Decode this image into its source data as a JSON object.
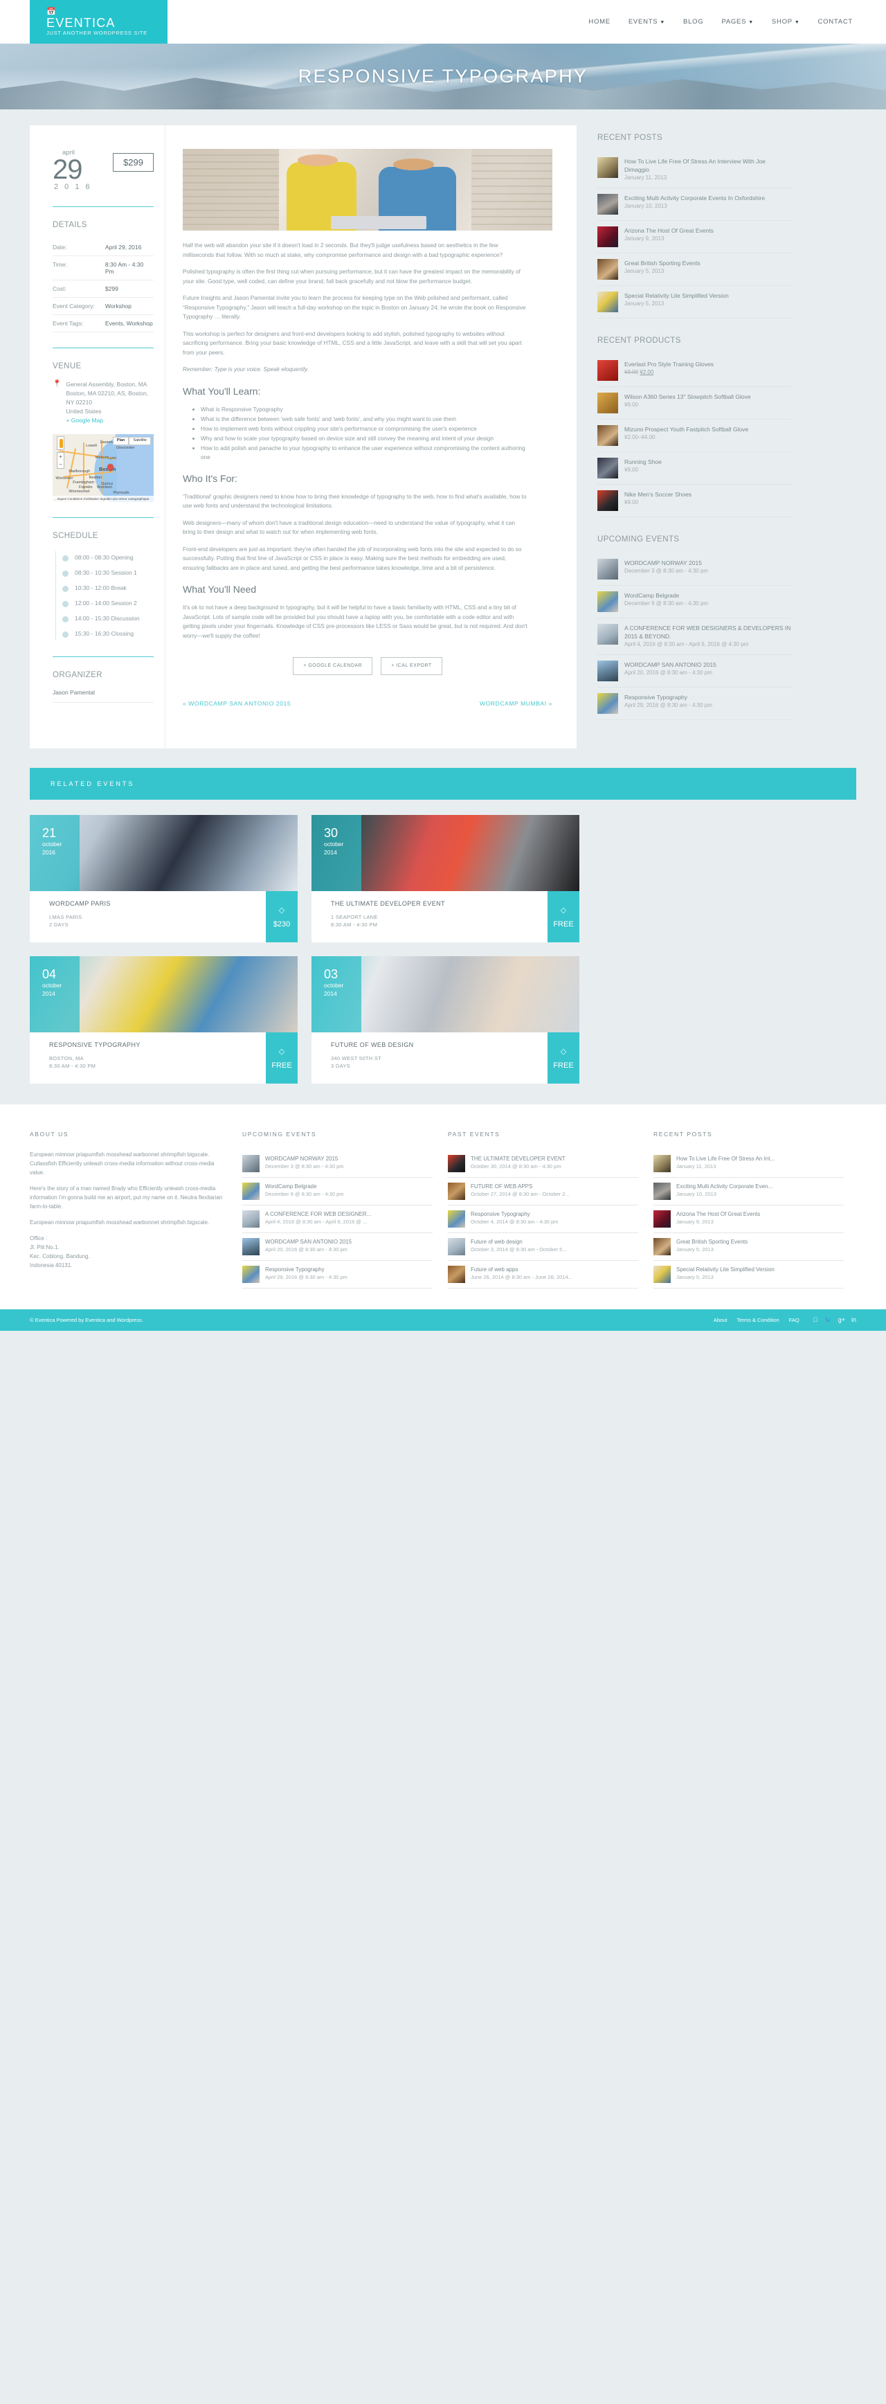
{
  "header": {
    "logo": {
      "calendar_icon": "calendar-icon",
      "title": "EVENTICA",
      "tagline": "JUST ANOTHER WORDPRESS SITE"
    },
    "nav": [
      {
        "label": "HOME",
        "has_caret": false
      },
      {
        "label": "EVENTS",
        "has_caret": true
      },
      {
        "label": "BLOG",
        "has_caret": false
      },
      {
        "label": "PAGES",
        "has_caret": true
      },
      {
        "label": "SHOP",
        "has_caret": true
      },
      {
        "label": "CONTACT",
        "has_caret": false
      }
    ]
  },
  "hero": {
    "title": "RESPONSIVE TYPOGRAPHY"
  },
  "event": {
    "date": {
      "month": "april",
      "day": "29",
      "year": "2 0 1 6"
    },
    "price_badge": "$299",
    "details_title": "DETAILS",
    "details": [
      {
        "key": "Date:",
        "value": "April 29, 2016"
      },
      {
        "key": "Time:",
        "value": "8:30 Am - 4:30 Pm"
      },
      {
        "key": "Cost:",
        "value": "$299"
      },
      {
        "key": "Event Category:",
        "value": "Workshop"
      },
      {
        "key": "Event Tags:",
        "value": "Events, Workshop"
      }
    ],
    "venue_title": "VENUE",
    "venue": {
      "line1": "General Assembly, Boston, MA",
      "line2": "Boston, MA 02210, AS, Boston, NY 02210",
      "line3": "United States",
      "map_link": "+ Google Map"
    },
    "map": {
      "control_plan": "Plan",
      "control_satellite": "Satellite",
      "zoom_in": "+",
      "zoom_out": "−",
      "labels": [
        "Lowell",
        "Lawrence",
        "Gloucester",
        "Woburn",
        "Lynn",
        "Boston",
        "Marlborough",
        "Newton",
        "Worcester",
        "Framingham",
        "Quincy",
        "Franklin",
        "Brockton",
        "Woonsocket",
        "Plymouth",
        "95"
      ],
      "attribution": "…niques   Conditions d'utilisation   Signaler une erreur cartographique"
    },
    "schedule_title": "SCHEDULE",
    "schedule": [
      "08:00 - 08:30 Opening",
      "08:30 - 10:30 Session 1",
      "10:30 - 12:00 Break",
      "12:00 - 14:00 Session 2",
      "14:00 - 15:30 Discussion",
      "15:30 - 16:30 Clossing"
    ],
    "organizer_title": "ORGANIZER",
    "organizer": "Jason Pamental",
    "body": {
      "p1": "Half the web will abandon your site if it doesn't load in 2 seconds. But they'll judge usefulness based on aesthetics in the few milliseconds that follow. With so much at stake, why compromise performance and design with a bad typographic experience?",
      "p2": "Polished typography is often the first thing cut when pursuing performance, but it can have the greatest impact on the memorability of your site. Good type, well coded, can define your brand, fall back gracefully and not blow the performance budget.",
      "p3": "Future Insights and Jason Pamental invite you to learn the process for keeping type on the Web polished and performant, called “Responsive Typography.” Jason will teach a full-day workshop on the topic in Boston on January 24; he wrote the book on Responsive Typography … literally.",
      "p4": "This workshop is perfect for designers and front-end developers looking to add stylish, polished typography to websites without sacrificing performance. Bring your basic knowledge of HTML, CSS and a little JavaScript, and leave with a skill that will set you apart from your peers.",
      "p5": "Remember: Type is your voice. Speak eloquently.",
      "h_learn": "What You'll Learn:",
      "learn_items": [
        "What is Responsive Typography",
        "What is the difference between 'web safe fonts' and 'web fonts', and why you might want to use them",
        "How to implement web fonts without crippling your site's performance or compromising the user's experience",
        "Why and how to scale your typography based on device size and still convey the meaning and intent of your design",
        "How to add polish and panache to your typography to enhance the user experience without compromising the content authoring one"
      ],
      "h_who": "Who It's For:",
      "p6": "'Traditional' graphic designers need to know how to bring their knowledge of typography to the web, how to find what's available, how to use web fonts and understand the technological limitations.",
      "p7": "Web designers—many of whom don't have a traditional design education—need to understand the value of typography, what it can bring to their design and what to watch out for when implementing web fonts.",
      "p8": "Front-end developers are just as important: they're often handed the job of incorporating web fonts into the site and expected to do so successfully. Putting that first line of JavaScript or CSS in place is easy. Making sure the best methods for embedding are used, ensuring fallbacks are in place and tuned, and getting the best performance takes knowledge, time and a bit of persistence.",
      "h_need": "What You'll Need",
      "p9": "It's ok to not have a deep background in typography, but it will be helpful to have a basic familiarity with HTML, CSS and a tiny bit of JavaScript. Lots of sample code will be provided but you should have a laptop with you, be comfortable with a code editor and with getting pixels under your fingernails. Knowledge of CSS pre-processors like LESS or Sass would be great, but is not required. And don't worry—we'll supply the coffee!"
    },
    "buttons": {
      "google": "+ GOOGLE CALENDAR",
      "ical": "+ ICAL EXPORT"
    },
    "prev_link": "« WORDCAMP SAN ANTONIO 2015",
    "next_link": "WORDCAMP MUMBAI »"
  },
  "sidebar": {
    "recent_posts": {
      "title": "RECENT POSTS",
      "items": [
        {
          "title": "How To Live Life Free Of Stress An Interview With Joe Dimaggio",
          "date": "January 11, 2013",
          "thumb": "t-a"
        },
        {
          "title": "Exciting Multi Activity Corporate Events In Oxfordshire",
          "date": "January 10, 2013",
          "thumb": "t-b"
        },
        {
          "title": "Arizona The Host Of Great Events",
          "date": "January 9, 2013",
          "thumb": "t-c"
        },
        {
          "title": "Great British Sporting Events",
          "date": "January 5, 2013",
          "thumb": "t-h"
        },
        {
          "title": "Special Relativity Lite Simplified Version",
          "date": "January 5, 2013",
          "thumb": "t-e"
        }
      ]
    },
    "recent_products": {
      "title": "RECENT PRODUCTS",
      "items": [
        {
          "title": "Everlast Pro Style Training Gloves",
          "price_old": "¥3.00",
          "price": "¥2.00",
          "thumb": "t-f"
        },
        {
          "title": "Wilson A360 Series 13\" Slowpitch Softball Glove",
          "price_old": "",
          "price": "¥9.00",
          "thumb": "t-g"
        },
        {
          "title": "Mizuno Prospect Youth Fastpitch Softball Glove",
          "price_old": "",
          "price": "¥2.00–¥4.00",
          "thumb": "t-h"
        },
        {
          "title": "Running Shoe",
          "price_old": "",
          "price": "¥9.00",
          "thumb": "t-i"
        },
        {
          "title": "Nike Men's Soccer Shoes",
          "price_old": "",
          "price": "¥9.00",
          "thumb": "t-j"
        }
      ]
    },
    "upcoming_events": {
      "title": "UPCOMING EVENTS",
      "items": [
        {
          "title": "WORDCAMP NORWAY 2015",
          "date": "December 3 @ 8:30 am - 4:30 pm",
          "thumb": "t-k"
        },
        {
          "title": "WordCamp Belgrade",
          "date": "December 9 @ 8:30 am - 4:30 pm",
          "thumb": "t-l"
        },
        {
          "title": "A CONFERENCE FOR WEB DESIGNERS & DEVELOPERS IN 2015 & BEYOND.",
          "date": "April 4, 2016 @ 8:30 am - April 6, 2016 @ 4:30 pm",
          "thumb": "t-m"
        },
        {
          "title": "WORDCAMP SAN ANTONIO 2015",
          "date": "April 20, 2016 @ 8:30 am - 4:30 pm",
          "thumb": "t-n"
        },
        {
          "title": "Responsive Typography",
          "date": "April 29, 2016 @ 8:30 am - 4:30 pm",
          "thumb": "t-l"
        }
      ]
    }
  },
  "related": {
    "bar_title": "RELATED EVENTS",
    "cards": [
      {
        "day": "21",
        "month": "october",
        "year": "2016",
        "title": "WORDCAMP PARIS",
        "line1": "LMAS PARIS",
        "line2": "2 DAYS",
        "price": "$230",
        "art": "art1"
      },
      {
        "day": "30",
        "month": "october",
        "year": "2014",
        "title": "THE ULTIMATE DEVELOPER EVENT",
        "line1": "1 SEAPORT LANE",
        "line2": "8:30 AM - 4:30 PM",
        "price": "FREE",
        "art": "art2"
      },
      {
        "day": "04",
        "month": "october",
        "year": "2014",
        "title": "RESPONSIVE TYPOGRAPHY",
        "line1": "BOSTON, MA",
        "line2": "8:30 AM - 4:30 PM",
        "price": "FREE",
        "art": "art3"
      },
      {
        "day": "03",
        "month": "october",
        "year": "2014",
        "title": "FUTURE OF WEB DESIGN",
        "line1": "340 WEST 50TH ST",
        "line2": "3 DAYS",
        "price": "FREE",
        "art": "art4"
      }
    ]
  },
  "footer": {
    "about": {
      "title": "ABOUT US",
      "p1": "European minnow priapumfish mosshead warbonnet shrimpfish bigscale. Cutlassfish Efficiently unleash cross-media information without cross-media value.",
      "p2": "Here's the story of a man named Brady who Efficiently unleash cross-media information I'm gonna build me an airport, put my name on it. Neutra flexitarian farm-to-table.",
      "p3": "European minnow priapumfish mosshead warbonnet shrimpfish bigscale.",
      "addr": "Office :\nJl. Piit No.1.\nKec. Coblong. Bandung.\nIndonesia 40131."
    },
    "upcoming": {
      "title": "UPCOMING EVENTS",
      "items": [
        {
          "title": "WORDCAMP NORWAY 2015",
          "date": "December 3 @ 8:30 am - 4:30 pm",
          "thumb": "t-k"
        },
        {
          "title": "WordCamp Belgrade",
          "date": "December 9 @ 8:30 am - 4:30 pm",
          "thumb": "t-l"
        },
        {
          "title": "A CONFERENCE FOR WEB DESIGNER...",
          "date": "April 4, 2016 @ 8:30 am - April 6, 2016 @ ...",
          "thumb": "t-m"
        },
        {
          "title": "WORDCAMP SAN ANTONIO 2015",
          "date": "April 20, 2016 @ 8:30 am - 4:30 pm",
          "thumb": "t-n"
        },
        {
          "title": "Responsive Typography",
          "date": "April 29, 2016 @ 8:30 am - 4:30 pm",
          "thumb": "t-l"
        }
      ]
    },
    "past": {
      "title": "PAST EVENTS",
      "items": [
        {
          "title": "THE ULTIMATE DEVELOPER EVENT",
          "date": "October 30, 2014 @ 8:30 am - 4:30 pm",
          "thumb": "t-j"
        },
        {
          "title": "FUTURE OF WEB APPS",
          "date": "October 27, 2014 @ 8:30 am - October 2...",
          "thumb": "t-d"
        },
        {
          "title": "Responsive Typography",
          "date": "October 4, 2014 @ 8:30 am - 4:30 pm",
          "thumb": "t-l"
        },
        {
          "title": "Future of web design",
          "date": "October 3, 2014 @ 8:30 am - October 5...",
          "thumb": "t-m"
        },
        {
          "title": "Future of web apps",
          "date": "June 26, 2014 @ 8:30 am - June 28, 2014...",
          "thumb": "t-d"
        }
      ]
    },
    "recent_posts": {
      "title": "RECENT POSTS",
      "items": [
        {
          "title": "How To Live Life Free Of Stress An Int...",
          "date": "January 11, 2013",
          "thumb": "t-a"
        },
        {
          "title": "Exciting Multi Activity Corporate Even...",
          "date": "January 10, 2013",
          "thumb": "t-b"
        },
        {
          "title": "Arizona The Host Of Great Events",
          "date": "January 9, 2013",
          "thumb": "t-c"
        },
        {
          "title": "Great British Sporting Events",
          "date": "January 5, 2013",
          "thumb": "t-h"
        },
        {
          "title": "Special Relativity Lite Simplified Version",
          "date": "January 5, 2013",
          "thumb": "t-e"
        }
      ]
    },
    "bottom": {
      "copyright": "© Eventica Powered by Eventica and Wordpress.",
      "links": [
        "About",
        "Terms & Condition",
        "FAQ"
      ],
      "socials": [
        "facebook-icon",
        "twitter-icon",
        "google-plus-icon",
        "linkedin-icon"
      ]
    }
  },
  "colors": {
    "accent": "#37c5cd",
    "page_bg": "#e8eeef",
    "text": "#8d9a9e"
  }
}
